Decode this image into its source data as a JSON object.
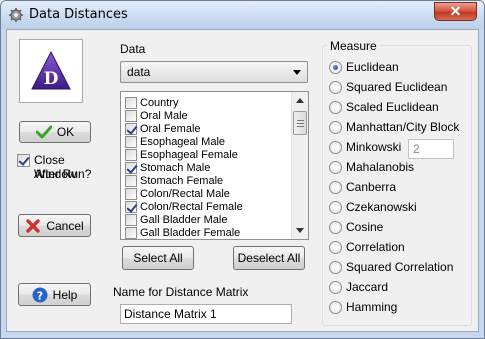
{
  "window": {
    "title": "Data Distances",
    "close_glyph": "✕"
  },
  "logo": {
    "letter": "D"
  },
  "buttons": {
    "ok": "OK",
    "cancel": "Cancel",
    "help": "Help",
    "select_all": "Select All",
    "deselect_all": "Deselect All"
  },
  "close_after_run": {
    "label_line1": "Close Window",
    "label_line2": "After Run?",
    "checked": true
  },
  "data": {
    "label": "Data",
    "selected": "data",
    "items": [
      {
        "label": "Country",
        "checked": false
      },
      {
        "label": "Oral Male",
        "checked": false
      },
      {
        "label": "Oral Female",
        "checked": true
      },
      {
        "label": "Esophageal Male",
        "checked": false
      },
      {
        "label": "Esophageal Female",
        "checked": false
      },
      {
        "label": "Stomach Male",
        "checked": true
      },
      {
        "label": "Stomach Female",
        "checked": false
      },
      {
        "label": "Colon/Rectal Male",
        "checked": false
      },
      {
        "label": "Colon/Rectal Female",
        "checked": true
      },
      {
        "label": "Gall Bladder Male",
        "checked": false
      },
      {
        "label": "Gall Bladder Female",
        "checked": false
      }
    ]
  },
  "distance_name": {
    "label": "Name for Distance Matrix",
    "value": "Distance Matrix 1"
  },
  "measure": {
    "label": "Measure",
    "selected": "Euclidean",
    "minkowski_value": "2",
    "options": [
      "Euclidean",
      "Squared Euclidean",
      "Scaled Euclidean",
      "Manhattan/City Block",
      "Minkowski",
      "Mahalanobis",
      "Canberra",
      "Czekanowski",
      "Cosine",
      "Correlation",
      "Squared Correlation",
      "Jaccard",
      "Hamming"
    ]
  },
  "colors": {
    "accent": "#2a3f8f",
    "logo_purple": "#5a2aa0",
    "ok_green": "#3aa52a",
    "cancel_red": "#d03030",
    "help_blue": "#2a63c8"
  },
  "icons": {
    "title": "app-icon",
    "ok": "checkmark-icon",
    "cancel": "x-icon",
    "help": "question-icon"
  }
}
